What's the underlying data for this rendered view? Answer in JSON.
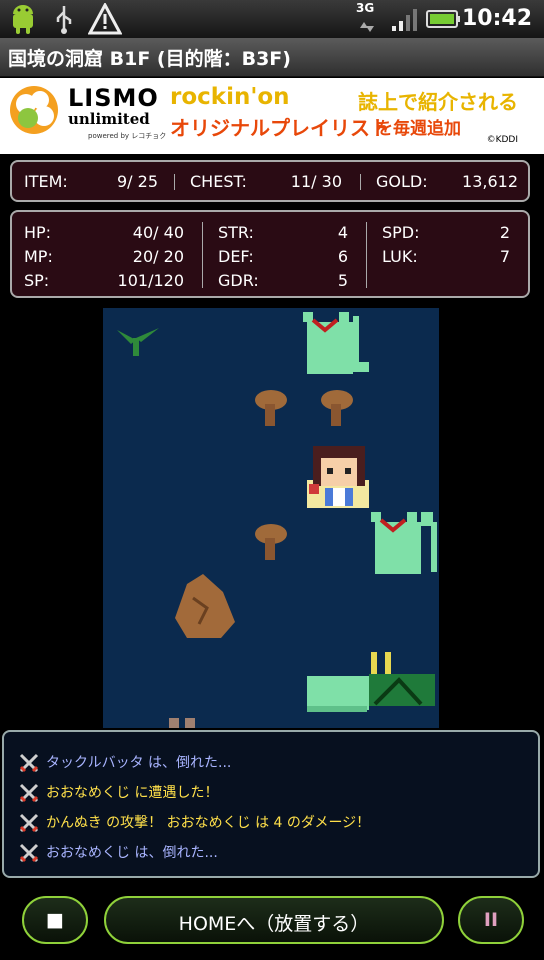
{
  "status_bar": {
    "time": "10:42",
    "network": "3G"
  },
  "title": "国境の洞窟 B1F (目的階：B3F)",
  "ad": {
    "brand": "LISMO",
    "sub": "unlimited",
    "powered": "powered by レコチョク",
    "magazine": "rockin'on",
    "magazine_suffix": "誌上で紹介される",
    "playlist": "オリジナルプレイリスト",
    "playlist_suffix": "を毎週追加",
    "copyright": "©KDDI"
  },
  "summary": {
    "item_label": "ITEM:",
    "item_value": "9/ 25",
    "chest_label": "CHEST:",
    "chest_value": "11/ 30",
    "gold_label": "GOLD:",
    "gold_value": "13,612"
  },
  "stats": {
    "hp_label": "HP:",
    "hp_value": "40/ 40",
    "mp_label": "MP:",
    "mp_value": "20/ 20",
    "sp_label": "SP:",
    "sp_value": "101/120",
    "str_label": "STR:",
    "str_value": "4",
    "def_label": "DEF:",
    "def_value": "6",
    "gdr_label": "GDR:",
    "gdr_value": "5",
    "spd_label": "SPD:",
    "spd_value": "2",
    "luk_label": "LUK:",
    "luk_value": "7"
  },
  "log": [
    {
      "text": "タックルバッタ は、倒れた...",
      "color": "#a8b4ff"
    },
    {
      "text": "おおなめくじ に遭遇した！",
      "color": "#ffe04a"
    },
    {
      "text": "かんぬき の攻撃！ おおなめくじ は 4 のダメージ！",
      "color": "#ffe04a"
    },
    {
      "text": "おおなめくじ は、倒れた...",
      "color": "#a8b4ff"
    }
  ],
  "buttons": {
    "stop": "■",
    "home": "HOMEへ（放置する）",
    "pause": "II"
  },
  "colors": {
    "panel_bg": "#2a0b14",
    "field_bg": "#0b2a4e",
    "button_border": "#8fd13a",
    "log_info": "#a8b4ff",
    "log_event": "#ffe04a"
  }
}
